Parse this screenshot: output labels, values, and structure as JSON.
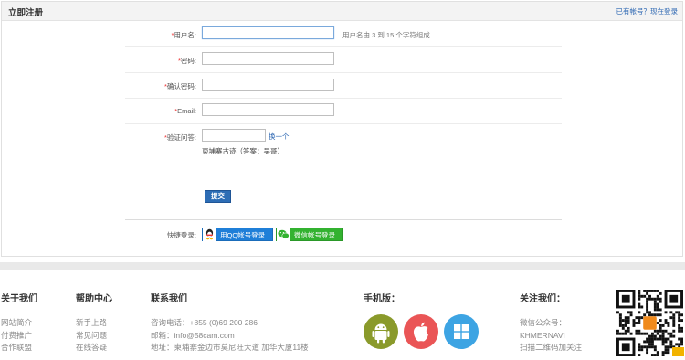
{
  "header": {
    "title": "立即注册",
    "login_link": "已有帐号？现在登录"
  },
  "form": {
    "username": {
      "label": "用户名:",
      "value": "",
      "hint": "用户名由 3 到 15 个字符组成"
    },
    "password": {
      "label": "密码:",
      "value": ""
    },
    "confirm_password": {
      "label": "确认密码:",
      "value": ""
    },
    "email": {
      "label": "Email:",
      "value": ""
    },
    "captcha": {
      "label": "验证问答:",
      "value": "",
      "refresh": "换一个",
      "question": "柬埔寨古迹（答案：吴哥）"
    },
    "submit_label": "提交",
    "quick_login": {
      "label": "快捷登录:",
      "qq_label": "用QQ帐号登录",
      "wechat_label": "微信帐号登录"
    },
    "required_mark": "*"
  },
  "footer": {
    "about": {
      "title": "关于我们",
      "links": [
        "网站简介",
        "付费推广",
        "合作联盟"
      ]
    },
    "help": {
      "title": "帮助中心",
      "links": [
        "新手上路",
        "常见问题",
        "在线答疑"
      ]
    },
    "contact": {
      "title": "联系我们",
      "phone": "咨询电话：+855 (0)69 200 286",
      "email": "邮箱：info@58cam.com",
      "address": "地址：柬埔寨金边市莫尼旺大道 加华大厦11楼"
    },
    "mobile": {
      "title": "手机版：",
      "apps": [
        {
          "icon": "android-icon",
          "color": "#8a9a2b"
        },
        {
          "icon": "apple-icon",
          "color": "#ea5556"
        },
        {
          "icon": "windows-icon",
          "color": "#3da4e3"
        }
      ]
    },
    "follow": {
      "title": "关注我们：",
      "lines": [
        "微信公众号：",
        "KHMERNAVI",
        "扫描二维码加关注"
      ]
    }
  },
  "colors": {
    "link": "#2b66b2",
    "submit": "#2d6db5",
    "qq": "#1f7fd8",
    "wechat": "#33b230",
    "required": "#ee3333"
  }
}
